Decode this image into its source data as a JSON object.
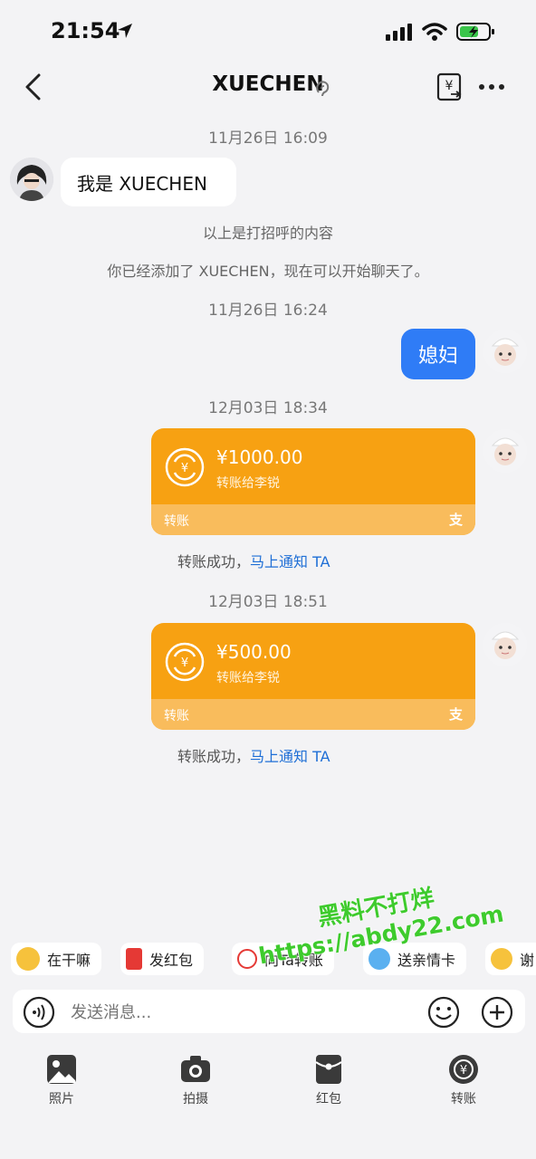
{
  "status_bar": {
    "time": "21:54"
  },
  "header": {
    "title": "XUECHEN"
  },
  "messages": {
    "t1": "11月26日 16:09",
    "greet": "我是 XUECHEN",
    "sys1": "以上是打招呼的内容",
    "sys2": "你已经添加了 XUECHEN，现在可以开始聊天了。",
    "t2": "11月26日 16:24",
    "mine": "媳妇",
    "t3": "12月03日 18:34",
    "t4": "12月03日 18:51"
  },
  "transfers": [
    {
      "amount": "¥1000.00",
      "to": "转账给李锐",
      "label": "转账",
      "status": "转账成功，",
      "notify": "马上通知 TA"
    },
    {
      "amount": "¥500.00",
      "to": "转账给李锐",
      "label": "转账",
      "status": "转账成功，",
      "notify": "马上通知 TA"
    }
  ],
  "quick_chips": [
    "在干嘛",
    "发红包",
    "向Ta转账",
    "送亲情卡",
    "谢"
  ],
  "input": {
    "placeholder": "发送消息..."
  },
  "toolbar": [
    "照片",
    "拍摄",
    "红包",
    "转账"
  ],
  "watermark": {
    "line1": "黑料不打烊",
    "line2": "https://abdy22.com"
  },
  "colors": {
    "accent_blue": "#2f7cf6",
    "transfer_orange": "#f7a112",
    "link_blue": "#1f6fd6"
  }
}
